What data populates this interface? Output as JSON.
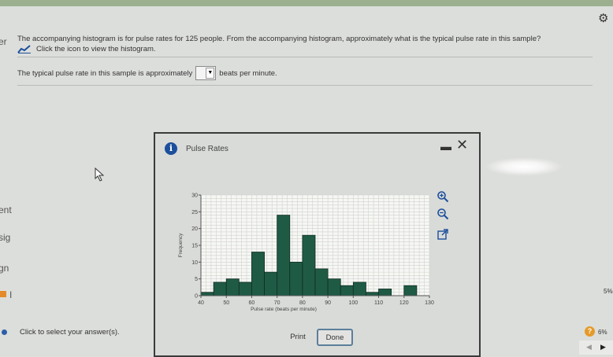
{
  "question": {
    "text": "The accompanying histogram is for pulse rates for 125 people. From the accompanying histogram, approximately what is the typical pulse rate in this sample?",
    "link_text": "Click the icon to view the histogram."
  },
  "answer": {
    "prefix": "The typical pulse rate in this sample is approximately",
    "dropdown_arrow": "▼",
    "suffix": "beats per minute."
  },
  "left_fragments": [
    "er",
    "ent",
    "sig",
    "gn",
    "I"
  ],
  "dialog": {
    "title": "Pulse Rates",
    "minimize": "▬",
    "close": "✕",
    "print_label": "Print",
    "done_label": "Done",
    "tools": [
      "zoom-in-icon",
      "zoom-out-icon",
      "external-link-icon"
    ]
  },
  "chart_data": {
    "type": "bar",
    "xlabel": "Pulse rate (beats per minute)",
    "ylabel": "Frequency",
    "bin_width": 5,
    "bin_starts": [
      40,
      45,
      50,
      55,
      60,
      65,
      70,
      75,
      80,
      85,
      90,
      95,
      100,
      105,
      110,
      115,
      120,
      125
    ],
    "values": [
      1,
      4,
      5,
      4,
      13,
      7,
      24,
      10,
      18,
      8,
      5,
      3,
      4,
      1,
      2,
      0,
      3,
      0
    ],
    "xticks": [
      40,
      50,
      60,
      70,
      80,
      90,
      100,
      110,
      120,
      130
    ],
    "yticks": [
      0,
      5,
      10,
      15,
      20,
      25,
      30
    ],
    "xlim": [
      40,
      130
    ],
    "ylim": [
      0,
      30
    ],
    "grid": true,
    "bar_color": "#1f5a45"
  },
  "footer": {
    "select_text": "Click to select your answer(s).",
    "help": "?",
    "pct_right": "6%",
    "pct_side": "5%",
    "nav_prev": "◀",
    "nav_next": "▶"
  },
  "colors": {
    "accent": "#1c4f9c",
    "done_border": "#5b7f9a",
    "help": "#e59a2a"
  }
}
